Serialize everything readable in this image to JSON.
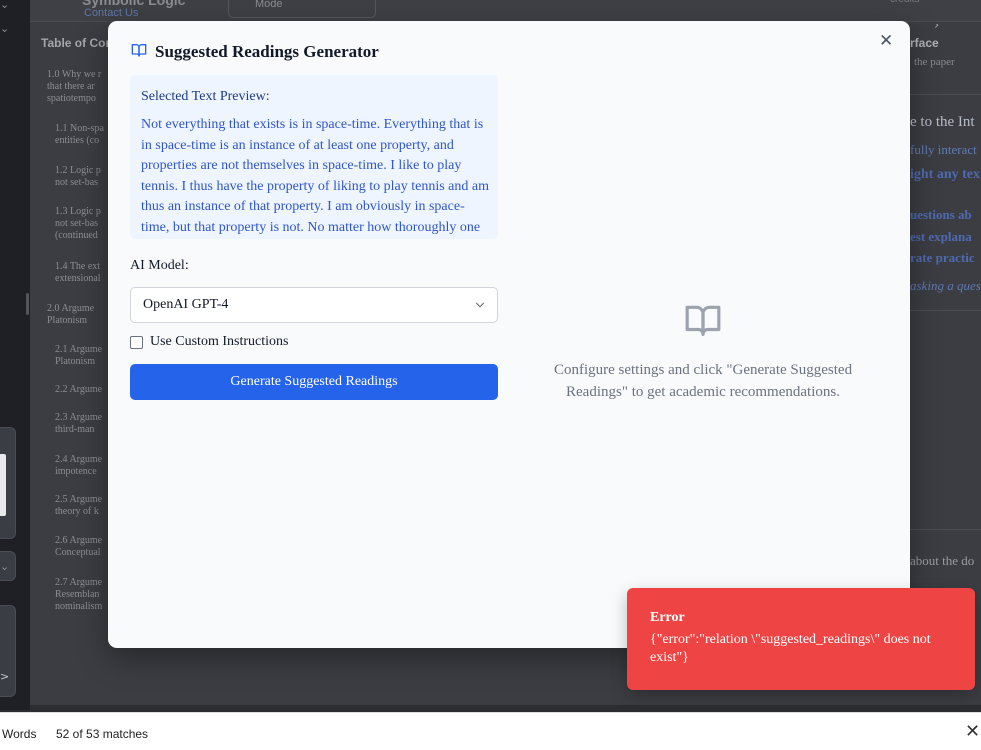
{
  "background_app": {
    "brand": "Symbolic Logic",
    "contact_link": "Contact Us",
    "mode_label": "Mode",
    "credits_label": "credits",
    "toc": {
      "title": "Table of Contents",
      "items": [
        "1.0 Why we r",
        "that there ar",
        "spatiotempo",
        "1.1 Non-spa",
        "entities (co",
        "1.2 Logic p",
        "not set-bas",
        "1.3 Logic p",
        "not set-bas",
        "(continued",
        "1.4 The ext",
        "extensional",
        "2.0 Argume",
        "Platonism",
        "2.1 Argume",
        "Platonism",
        "2.2 Argume",
        "2.3 Argume",
        "third-man",
        "2.4 Argume",
        "impotence",
        "2.5 Argume",
        "theory of k",
        "2.6 Argume",
        "Conceptual",
        "2.7 Argume",
        "Resemblan",
        "nominalism"
      ]
    },
    "right_pane": {
      "title": "rface",
      "subtitle": "the paper",
      "welcome": "e to the Int",
      "lines": [
        "fully interact",
        "ight any tex",
        "uestions ab",
        "est explana",
        "rate practic",
        "asking a ques"
      ],
      "footer": "about the do"
    }
  },
  "modal": {
    "title": "Suggested Readings Generator",
    "title_icon": "book-open-icon",
    "close_icon": "close-icon",
    "preview": {
      "label": "Selected Text Preview:",
      "text": "Not everything that exists is in space-time. Everything that is in space-time is an instance of at least one property, and properties are not themselves in space-time. I like to play tennis. I thus have the property of liking to play tennis and am thus an instance of that property. I am obviously in space-time, but that property is not. No matter how thoroughly one"
    },
    "model_label": "AI Model:",
    "model_value": "OpenAI GPT-4",
    "custom_instructions_label": "Use Custom Instructions",
    "custom_instructions_checked": false,
    "generate_label": "Generate Suggested Readings",
    "empty_state_icon": "book-open-icon",
    "empty_state_text": "Configure settings and click \"Generate Suggested Readings\" to get academic recommendations."
  },
  "toast": {
    "title": "Error",
    "message": "{\"error\":\"relation \\\"suggested_readings\\\" does not exist\"}"
  },
  "findbar": {
    "mode": "Words",
    "count": "52 of 53 matches"
  },
  "colors": {
    "primary": "#2563eb",
    "error": "#ef4444",
    "preview_bg": "#eef5fe",
    "preview_text": "#2f56c9"
  }
}
